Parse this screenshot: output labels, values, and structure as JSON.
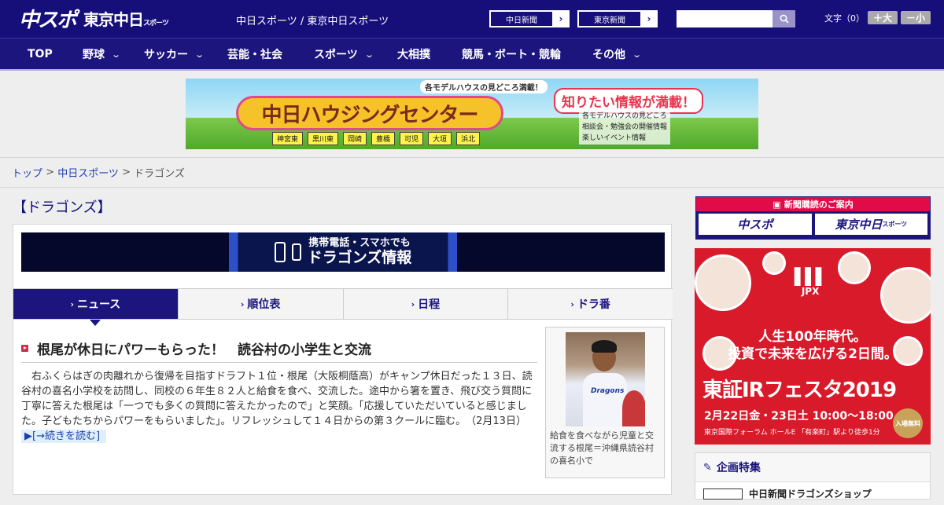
{
  "header": {
    "logo_chuspo": "中スポ",
    "logo_tokyo": "東京中日",
    "logo_tokyo_sub": "スポーツ",
    "site_title": "中日スポーツ / 東京中日スポーツ",
    "paper_links": [
      {
        "label": "中日新聞",
        "arrow": "›"
      },
      {
        "label": "東京新聞",
        "arrow": "›"
      }
    ],
    "search": {
      "placeholder": "",
      "value": ""
    },
    "fontsize": {
      "label": "文字（0）",
      "increase": "＋大",
      "decrease": "－小"
    }
  },
  "nav": [
    {
      "label": "TOP",
      "has_menu": false
    },
    {
      "label": "野球",
      "has_menu": true
    },
    {
      "label": "サッカー",
      "has_menu": true
    },
    {
      "label": "芸能・社会",
      "has_menu": false
    },
    {
      "label": "スポーツ",
      "has_menu": true
    },
    {
      "label": "大相撲",
      "has_menu": false
    },
    {
      "label": "競馬・ボート・競輪",
      "has_menu": false
    },
    {
      "label": "その他",
      "has_menu": true
    }
  ],
  "ad_banner": {
    "pill": "各モデルハウスの見どころ満載！",
    "title": "中日ハウジングセンター",
    "headline": "知りたい情報が満載！",
    "info_lines": [
      "各モデルハウスの見どころ",
      "相談会・勉強会の開催情報",
      "楽しいイベント情報"
    ],
    "cities": [
      "神宮東",
      "黒川東",
      "岡崎",
      "豊橋",
      "可児",
      "大垣",
      "浜北"
    ]
  },
  "breadcrumb": {
    "home": "トップ",
    "sep": " > ",
    "section": "中日スポーツ",
    "current": "ドラゴンズ"
  },
  "page_heading": "【ドラゴンズ】",
  "mobile_banner": {
    "line1": "携帯電話・スマホでも",
    "line2": "ドラゴンズ情報"
  },
  "tabs": [
    {
      "label": "ニュース",
      "active": true
    },
    {
      "label": "順位表",
      "active": false
    },
    {
      "label": "日程",
      "active": false
    },
    {
      "label": "ドラ番",
      "active": false
    }
  ],
  "article": {
    "title": "根尾が休日にパワーもらった！　読谷村の小学生と交流",
    "body": "右ふくらはぎの肉離れから復帰を目指すドラフト１位・根尾（大阪桐蔭高）がキャンプ休日だった１３日、読谷村の喜名小学校を訪問し、同校の６年生８２人と給食を食べ、交流した。途中から箸を置き、飛び交う質問に丁寧に答えた根尾は「一つでも多くの質問に答えたかったので」と笑顔。「応援していただいていると感じました。子どもたちからパワーをもらいました」。リフレッシュして１４日からの第３クールに臨む。",
    "date": "（2月13日）",
    "read_more": "[→続きを読む]",
    "photo_caption": "給食を食べながら児童と交流する根尾＝沖縄県読谷村の喜名小で",
    "photo_uniform_text": "Dragons"
  },
  "sidebar": {
    "subscribe": {
      "title": "新聞購読のご案内",
      "chuspo": "中スポ",
      "tokyo": "東京中日",
      "tokyo_sub": "スポーツ"
    },
    "jpx_ad": {
      "brand": "JPX",
      "line1": "人生100年時代。",
      "line2": "投資で未来を広げる2日間。",
      "title": "東証IRフェスタ2019",
      "date": "2月22日金・23日土 10:00～18:00",
      "venue": "東京国際フォーラム ホールE 「有楽町」駅より徒歩1分",
      "free": "入場無料"
    },
    "special": {
      "title": "企画特集",
      "item": "中日新聞ドラゴンズショップ"
    }
  },
  "colors": {
    "brand_navy": "#160f7a",
    "nav_navy": "#1c157e",
    "accent_red": "#d42a4a",
    "jpx_red": "#d91a2a"
  }
}
